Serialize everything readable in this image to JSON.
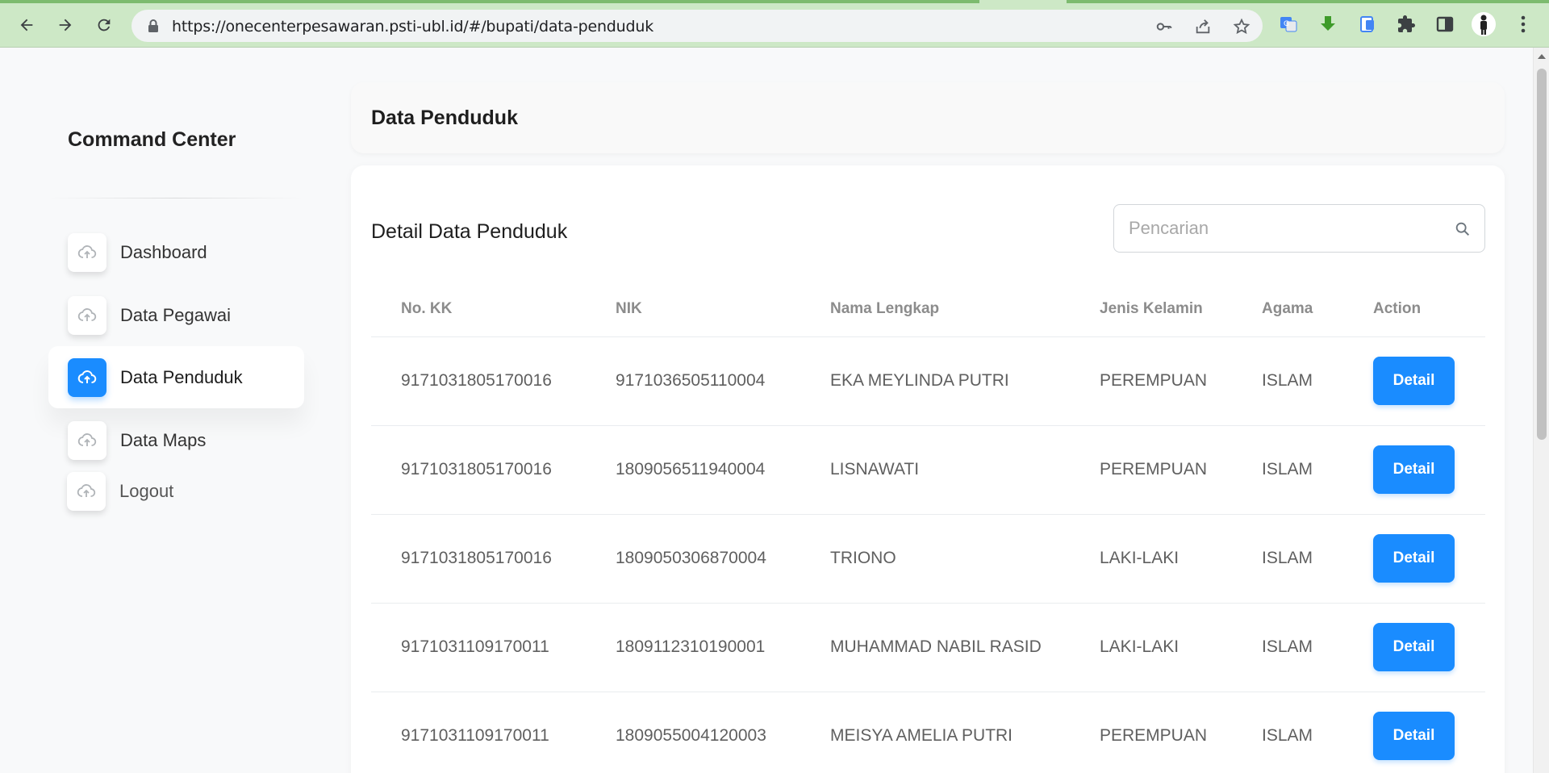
{
  "browser": {
    "url": "https://onecenterpesawaran.psti-ubl.id/#/bupati/data-penduduk",
    "accent": "#cde8c6"
  },
  "sidebar": {
    "brand": "Command Center",
    "items": [
      {
        "label": "Dashboard",
        "icon": "cloud-upload-icon",
        "active": false
      },
      {
        "label": "Data Pegawai",
        "icon": "cloud-upload-icon",
        "active": false
      },
      {
        "label": "Data Penduduk",
        "icon": "cloud-upload-icon",
        "active": true
      },
      {
        "label": "Data Maps",
        "icon": "cloud-upload-icon",
        "active": false
      },
      {
        "label": "Logout",
        "icon": "cloud-upload-icon",
        "active": false
      }
    ]
  },
  "header": {
    "title": "Data Penduduk"
  },
  "main": {
    "card_title": "Detail Data Penduduk",
    "search": {
      "placeholder": "Pencarian",
      "value": ""
    },
    "columns": [
      "No. KK",
      "NIK",
      "Nama Lengkap",
      "Jenis Kelamin",
      "Agama",
      "Action"
    ],
    "rows": [
      {
        "kk": "9171031805170016",
        "nik": "9171036505110004",
        "nama": "EKA MEYLINDA PUTRI",
        "jk": "PEREMPUAN",
        "agama": "ISLAM",
        "action": "Detail"
      },
      {
        "kk": "9171031805170016",
        "nik": "1809056511940004",
        "nama": "LISNAWATI",
        "jk": "PEREMPUAN",
        "agama": "ISLAM",
        "action": "Detail"
      },
      {
        "kk": "9171031805170016",
        "nik": "1809050306870004",
        "nama": "TRIONO",
        "jk": "LAKI-LAKI",
        "agama": "ISLAM",
        "action": "Detail"
      },
      {
        "kk": "9171031109170011",
        "nik": "1809112310190001",
        "nama": "MUHAMMAD NABIL RASID",
        "jk": "LAKI-LAKI",
        "agama": "ISLAM",
        "action": "Detail"
      },
      {
        "kk": "9171031109170011",
        "nik": "1809055004120003",
        "nama": "MEISYA AMELIA PUTRI",
        "jk": "PEREMPUAN",
        "agama": "ISLAM",
        "action": "Detail"
      }
    ],
    "button_color": "#1a8cff"
  }
}
